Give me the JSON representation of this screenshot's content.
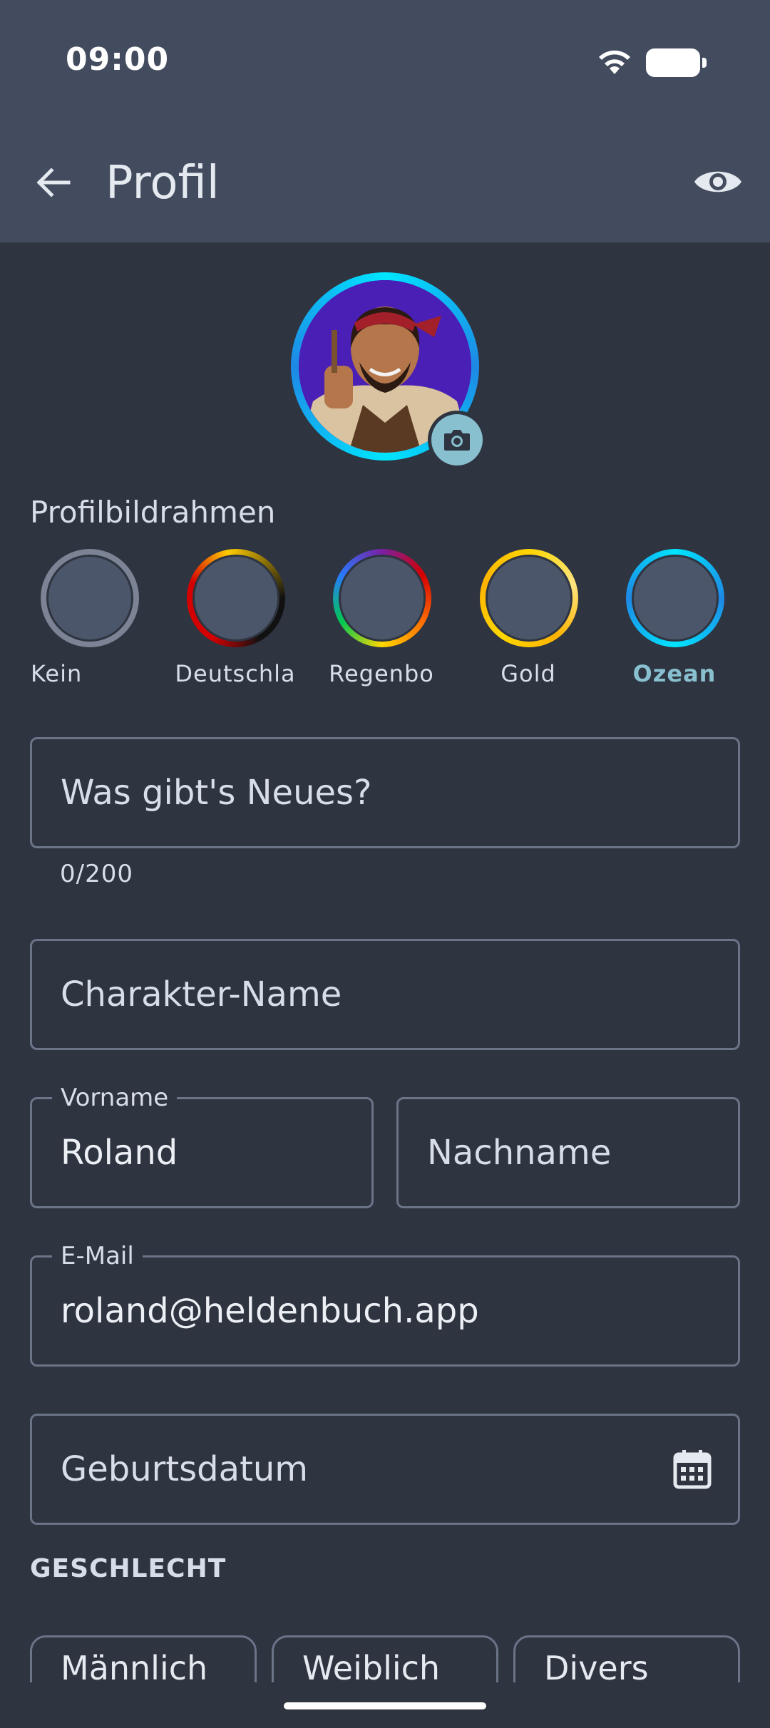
{
  "status_bar": {
    "time": "09:00"
  },
  "app_bar": {
    "title": "Profil",
    "back_icon": "arrow-left-icon",
    "preview_icon": "eye-icon"
  },
  "avatar": {
    "camera_icon": "camera-icon"
  },
  "frames": {
    "label": "Profilbildrahmen",
    "options": [
      {
        "name": "Kein",
        "selected": false
      },
      {
        "name": "Deutschla",
        "selected": false
      },
      {
        "name": "Regenbo",
        "selected": false
      },
      {
        "name": "Gold",
        "selected": false
      },
      {
        "name": "Ozean",
        "selected": true
      }
    ],
    "selected_color": "#88c0d0"
  },
  "status_field": {
    "placeholder": "Was gibt's Neues?",
    "counter": "0/200"
  },
  "character_field": {
    "placeholder": "Charakter-Name"
  },
  "first_name": {
    "label": "Vorname",
    "value": "Roland"
  },
  "last_name": {
    "placeholder": "Nachname"
  },
  "email": {
    "label": "E-Mail",
    "value": "roland@heldenbuch.app"
  },
  "birthdate": {
    "placeholder": "Geburtsdatum",
    "icon": "calendar-icon"
  },
  "gender": {
    "label": "GESCHLECHT",
    "options": [
      "Männlich",
      "Weiblich",
      "Divers"
    ]
  },
  "colors": {
    "background": "#2e3440",
    "app_bar": "#434c5e",
    "accent": "#88c0d0",
    "outline": "#6b7488"
  }
}
